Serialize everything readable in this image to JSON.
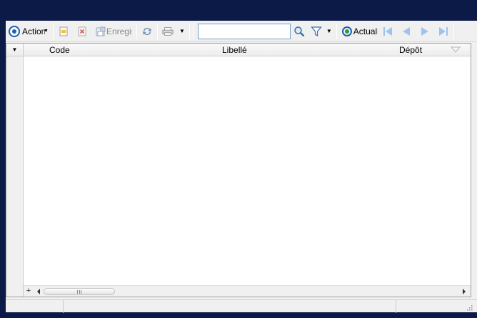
{
  "toolbar": {
    "actions_label": "Actions",
    "enregistrer_label": "Enregistrer",
    "actualiser_label": "Actualiser",
    "search_value": "",
    "search_placeholder": ""
  },
  "grid": {
    "columns": [
      {
        "label": "Code"
      },
      {
        "label": "Libellé"
      },
      {
        "label": "Dépôt"
      }
    ],
    "rows": []
  },
  "scrollbar": {
    "add_label": "+"
  },
  "statusbar": {
    "pane1": "",
    "pane2": "",
    "pane3": ""
  },
  "colors": {
    "desktop": "#0b1a47",
    "accent": "#1f5fb5",
    "toolbar": "#f0f0f0"
  }
}
